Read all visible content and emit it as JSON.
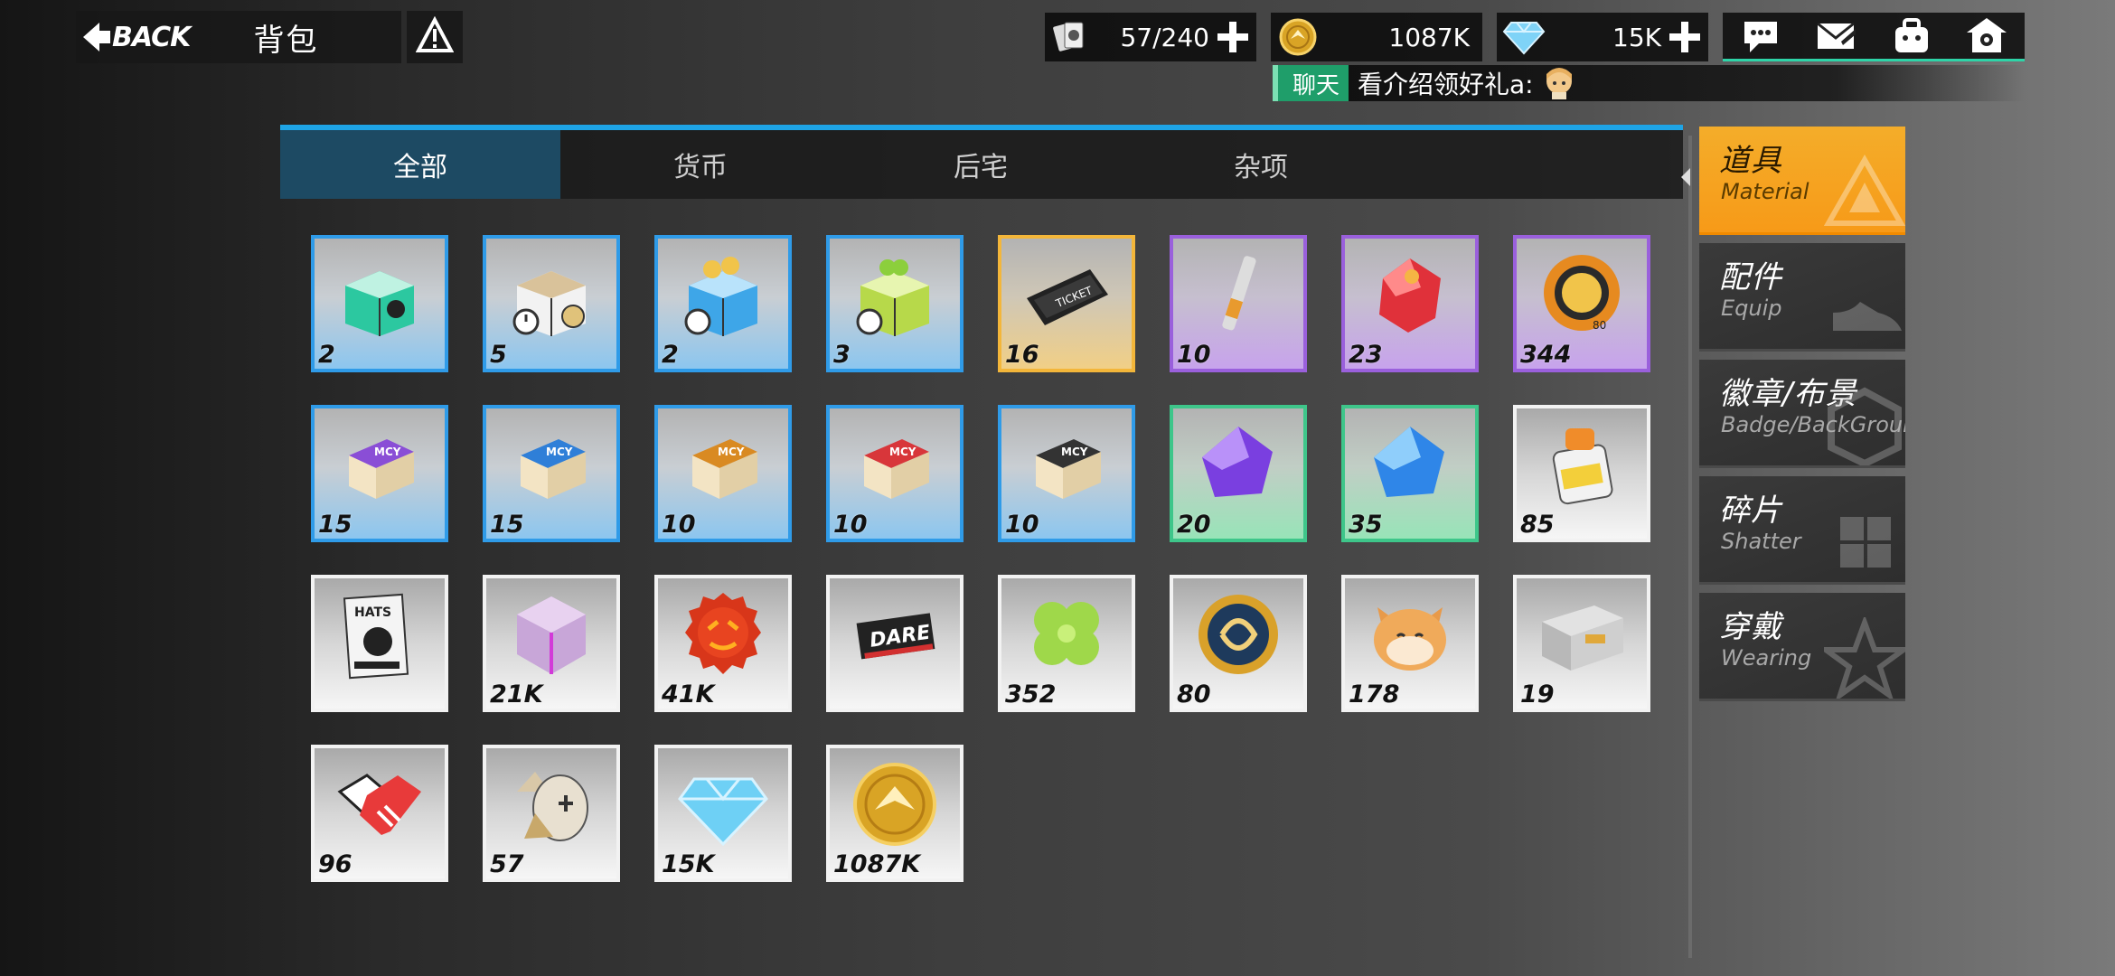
{
  "header": {
    "back_label": "BACK",
    "title": "背包"
  },
  "resources": {
    "capacity": "57/240",
    "gold": "1087K",
    "diamond": "15K"
  },
  "chat": {
    "tag": "聊天",
    "message": "看介绍领好礼a:"
  },
  "tabs": [
    {
      "label": "全部",
      "active": true
    },
    {
      "label": "货币",
      "active": false
    },
    {
      "label": "后宅",
      "active": false
    },
    {
      "label": "杂项",
      "active": false
    }
  ],
  "items": [
    {
      "count": "2",
      "rarity": "blue",
      "icon": "green-gift-box-icon"
    },
    {
      "count": "5",
      "rarity": "blue",
      "icon": "timed-gift-box-icon"
    },
    {
      "count": "2",
      "rarity": "blue",
      "icon": "coin-chest-icon"
    },
    {
      "count": "3",
      "rarity": "blue",
      "icon": "clover-chest-icon"
    },
    {
      "count": "16",
      "rarity": "gold",
      "icon": "voucher-ticket-icon"
    },
    {
      "count": "10",
      "rarity": "purple",
      "icon": "glue-tube-icon"
    },
    {
      "count": "23",
      "rarity": "purple",
      "icon": "red-crystal-icon"
    },
    {
      "count": "344",
      "rarity": "purple",
      "icon": "stamp-badge-icon"
    },
    {
      "count": "15",
      "rarity": "blue",
      "icon": "purple-eraser-icon"
    },
    {
      "count": "15",
      "rarity": "blue",
      "icon": "blue-eraser-icon"
    },
    {
      "count": "10",
      "rarity": "blue",
      "icon": "orange-eraser-icon"
    },
    {
      "count": "10",
      "rarity": "blue",
      "icon": "red-eraser-icon"
    },
    {
      "count": "10",
      "rarity": "blue",
      "icon": "black-eraser-icon"
    },
    {
      "count": "20",
      "rarity": "green",
      "icon": "purple-gem-icon"
    },
    {
      "count": "35",
      "rarity": "green",
      "icon": "blue-gem-icon"
    },
    {
      "count": "85",
      "rarity": "white",
      "icon": "paint-jar-icon"
    },
    {
      "count": "",
      "rarity": "white",
      "icon": "hats-magazine-icon"
    },
    {
      "count": "21K",
      "rarity": "white",
      "icon": "cube-fragment-icon"
    },
    {
      "count": "41K",
      "rarity": "white",
      "icon": "bottle-cap-icon"
    },
    {
      "count": "",
      "rarity": "white",
      "icon": "dare-card-icon"
    },
    {
      "count": "352",
      "rarity": "white",
      "icon": "clover-icon"
    },
    {
      "count": "80",
      "rarity": "white",
      "icon": "medal-coin-icon"
    },
    {
      "count": "178",
      "rarity": "white",
      "icon": "cat-face-icon"
    },
    {
      "count": "19",
      "rarity": "white",
      "icon": "supply-crate-icon"
    },
    {
      "count": "96",
      "rarity": "white",
      "icon": "handshake-icon"
    },
    {
      "count": "57",
      "rarity": "white",
      "icon": "mask-token-icon"
    },
    {
      "count": "15K",
      "rarity": "white",
      "icon": "diamond-icon"
    },
    {
      "count": "1087K",
      "rarity": "white",
      "icon": "gold-coin-icon"
    }
  ],
  "categories": [
    {
      "cn": "道具",
      "en": "Material",
      "active": true
    },
    {
      "cn": "配件",
      "en": "Equip",
      "active": false
    },
    {
      "cn": "徽章/布景",
      "en": "Badge/BackGround",
      "active": false
    },
    {
      "cn": "碎片",
      "en": "Shatter",
      "active": false
    },
    {
      "cn": "穿戴",
      "en": "Wearing",
      "active": false
    }
  ],
  "colors": {
    "accent_blue": "#1ea4e6",
    "tab_active": "#1d4a63",
    "category_active": "#f79a18",
    "chat_green": "#1f9e6a",
    "rarity_blue": "#2f9be8",
    "rarity_gold": "#f3b63a",
    "rarity_purple": "#9a60dc",
    "rarity_green": "#3ec68a"
  }
}
